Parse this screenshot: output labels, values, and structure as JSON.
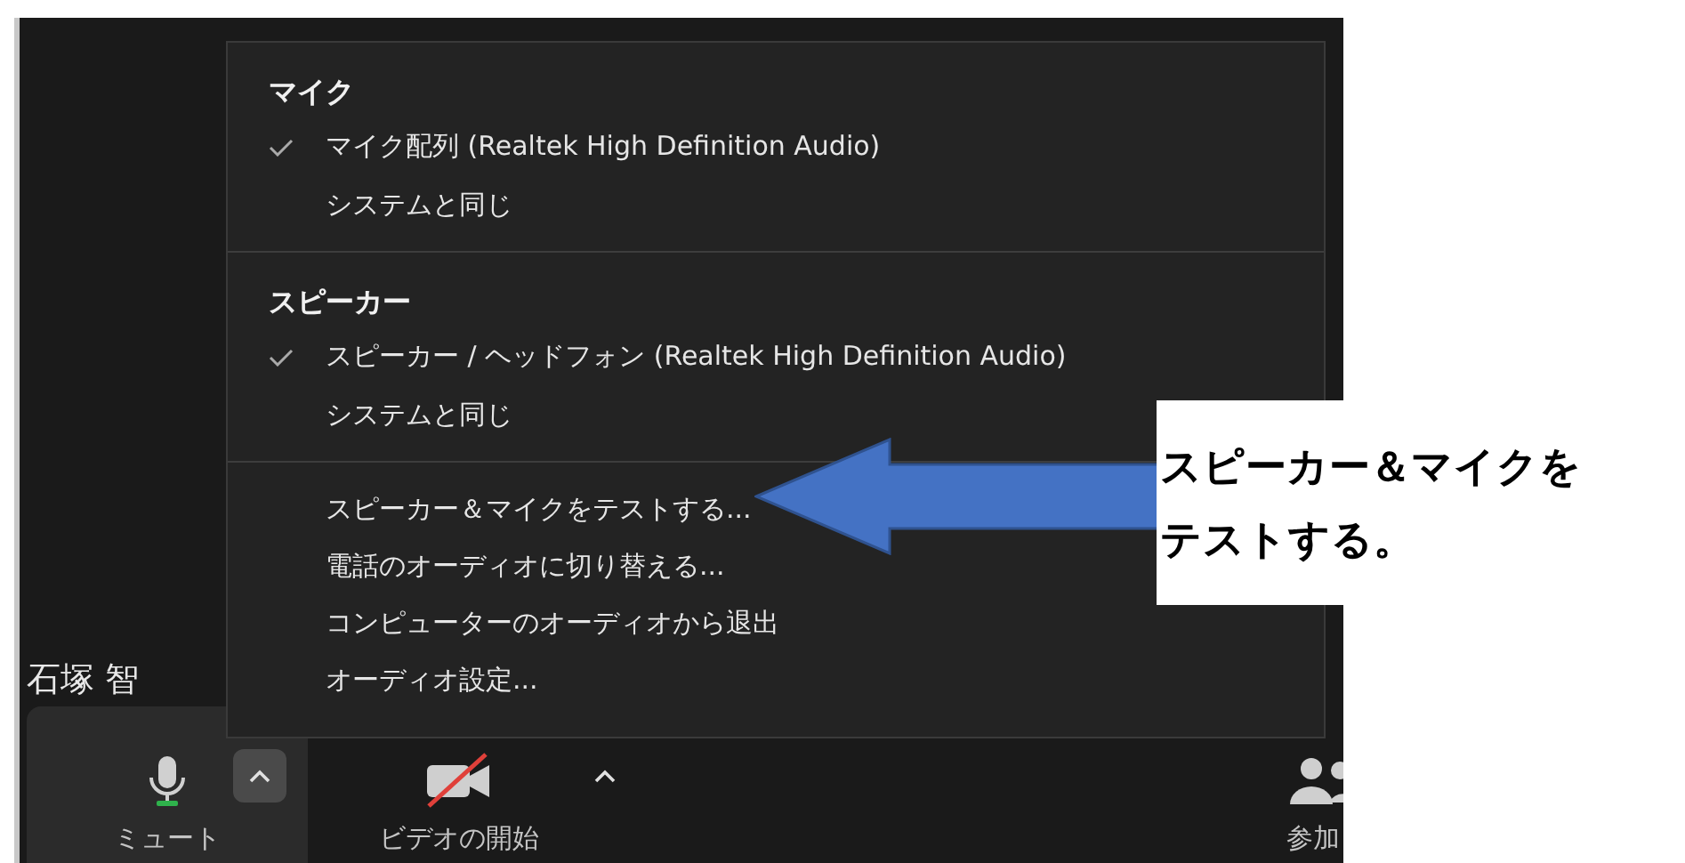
{
  "menu": {
    "sections": [
      {
        "heading": "マイク",
        "items": [
          {
            "label": "マイク配列 (Realtek High Definition Audio)",
            "checked": true
          },
          {
            "label": "システムと同じ",
            "checked": false
          }
        ]
      },
      {
        "heading": "スピーカー",
        "items": [
          {
            "label": "スピーカー / ヘッドフォン (Realtek High Definition Audio)",
            "checked": true
          },
          {
            "label": "システムと同じ",
            "checked": false
          }
        ]
      }
    ],
    "actions": [
      "スピーカー＆マイクをテストする...",
      "電話のオーディオに切り替える...",
      "コンピューターのオーディオから退出",
      "オーディオ設定..."
    ]
  },
  "participant_name": "石塚 智",
  "toolbar": [
    {
      "kind": "mic",
      "label": "ミュート",
      "caret": true,
      "caret_highlighted": true
    },
    {
      "kind": "video-off",
      "label": "ビデオの開始",
      "caret": true,
      "caret_highlighted": false
    },
    {
      "kind": "participants",
      "label": "参加",
      "caret": false
    }
  ],
  "callout": {
    "lines": [
      "スピーカー＆マイクを",
      "テストする。"
    ]
  }
}
